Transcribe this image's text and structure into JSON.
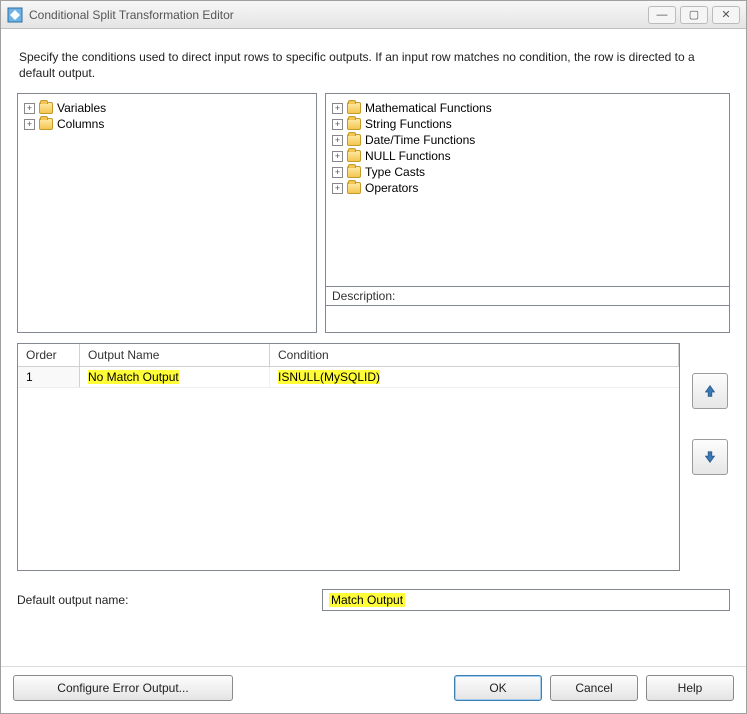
{
  "window": {
    "title": "Conditional Split Transformation Editor"
  },
  "intro": "Specify the conditions used to direct input rows to specific outputs. If an input row matches no condition, the row is directed to a default output.",
  "left_tree": {
    "items": [
      {
        "label": "Variables"
      },
      {
        "label": "Columns"
      }
    ]
  },
  "right_tree": {
    "items": [
      {
        "label": "Mathematical Functions"
      },
      {
        "label": "String Functions"
      },
      {
        "label": "Date/Time Functions"
      },
      {
        "label": "NULL Functions"
      },
      {
        "label": "Type Casts"
      },
      {
        "label": "Operators"
      }
    ]
  },
  "description_label": "Description:",
  "grid": {
    "headers": {
      "order": "Order",
      "name": "Output Name",
      "condition": "Condition"
    },
    "rows": [
      {
        "order": "1",
        "output_name": "No Match Output",
        "condition": "ISNULL(MySQLID)"
      }
    ]
  },
  "default_output": {
    "label": "Default output name:",
    "value": "Match Output"
  },
  "buttons": {
    "configure": "Configure Error Output...",
    "ok": "OK",
    "cancel": "Cancel",
    "help": "Help"
  }
}
